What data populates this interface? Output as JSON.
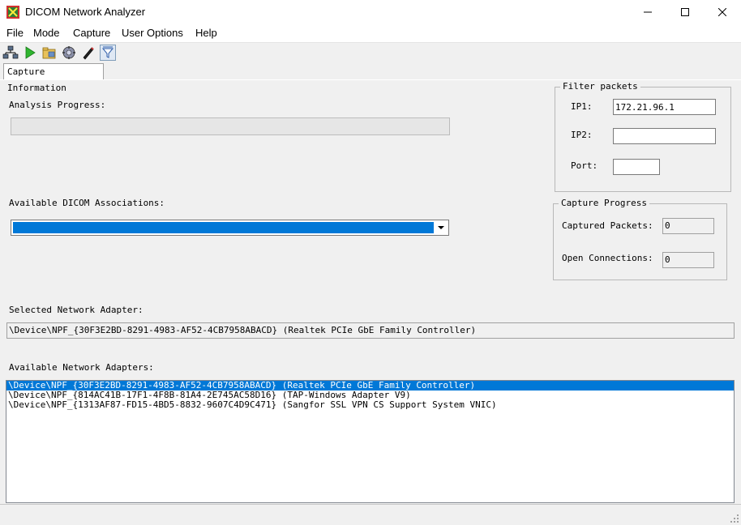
{
  "window": {
    "title": "DICOM Network Analyzer"
  },
  "menu": [
    "File",
    "Mode",
    "Capture",
    "User Options",
    "Help"
  ],
  "toolbar": [
    "adapter-icon",
    "play-icon",
    "open-folder-icon",
    "settings-icon",
    "edit-icon",
    "filter-icon"
  ],
  "tabs": [
    {
      "label": "Capture Information"
    }
  ],
  "analysis": {
    "label": "Analysis Progress:",
    "progress": 0
  },
  "associations": {
    "label": "Available DICOM Associations:",
    "selected": ""
  },
  "filter": {
    "title": "Filter packets",
    "ip1_label": "IP1:",
    "ip1_value": "172.21.96.1",
    "ip2_label": "IP2:",
    "ip2_value": "",
    "port_label": "Port:",
    "port_value": ""
  },
  "capture": {
    "title": "Capture Progress",
    "packets_label": "Captured Packets:",
    "packets_value": "0",
    "connections_label": "Open Connections:",
    "connections_value": "0"
  },
  "selected_adapter": {
    "label": "Selected Network Adapter:",
    "value": "\\Device\\NPF_{30F3E2BD-8291-4983-AF52-4CB7958ABACD} (Realtek PCIe GbE Family Controller)"
  },
  "adapters": {
    "label": "Available Network Adapters:",
    "items": [
      "\\Device\\NPF_{30F3E2BD-8291-4983-AF52-4CB7958ABACD} (Realtek PCIe GbE Family Controller)",
      "\\Device\\NPF_{814AC41B-17F1-4F8B-81A4-2E745AC58D16} (TAP-Windows Adapter V9)",
      "\\Device\\NPF_{1313AF87-FD15-4BD5-8832-9607C4D9C471} (Sangfor SSL VPN CS Support System VNIC)"
    ]
  },
  "colors": {
    "selection": "#0078d7",
    "background": "#f0f0f0"
  }
}
